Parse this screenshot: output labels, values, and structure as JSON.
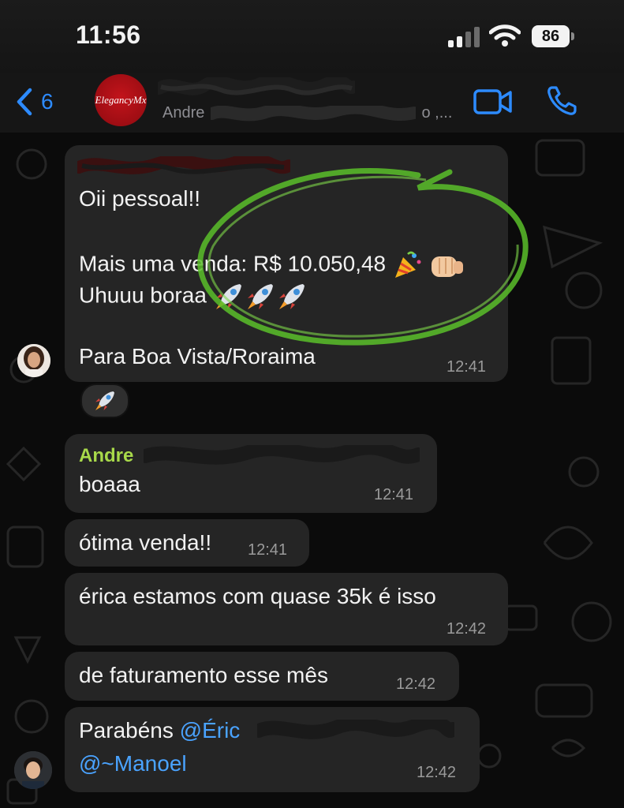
{
  "status_bar": {
    "time": "11:56",
    "battery": "86"
  },
  "header": {
    "back_count": "6",
    "group_avatar_text": "ElegancyMx",
    "subtitle_prefix": "Andre",
    "subtitle_suffix": "o ,..."
  },
  "messages": [
    {
      "sender": "",
      "lines": [
        "Oii pessoal!!",
        "",
        "Mais uma venda: R$ 10.050,48",
        "Uhuuu boraa",
        "",
        "Para Boa Vista/Roraima"
      ],
      "time": "12:41",
      "reaction": "rocket"
    },
    {
      "sender": "Andre",
      "text": "boaaa",
      "time": "12:41"
    },
    {
      "text": "ótima venda!!",
      "time": "12:41"
    },
    {
      "text": "érica estamos com quase 35k é isso",
      "time": "12:42"
    },
    {
      "text": "de faturamento esse mês",
      "time": "12:42"
    },
    {
      "prefix": "Parabéns ",
      "mention1": "@Éric",
      "mention2": "@~Manoel",
      "time": "12:42"
    }
  ],
  "colors": {
    "accent": "#2d8bff",
    "sender_andre": "#a8d94a",
    "mention": "#4aa3ff",
    "bubble": "#252525",
    "annotation": "#5bbf2a"
  }
}
